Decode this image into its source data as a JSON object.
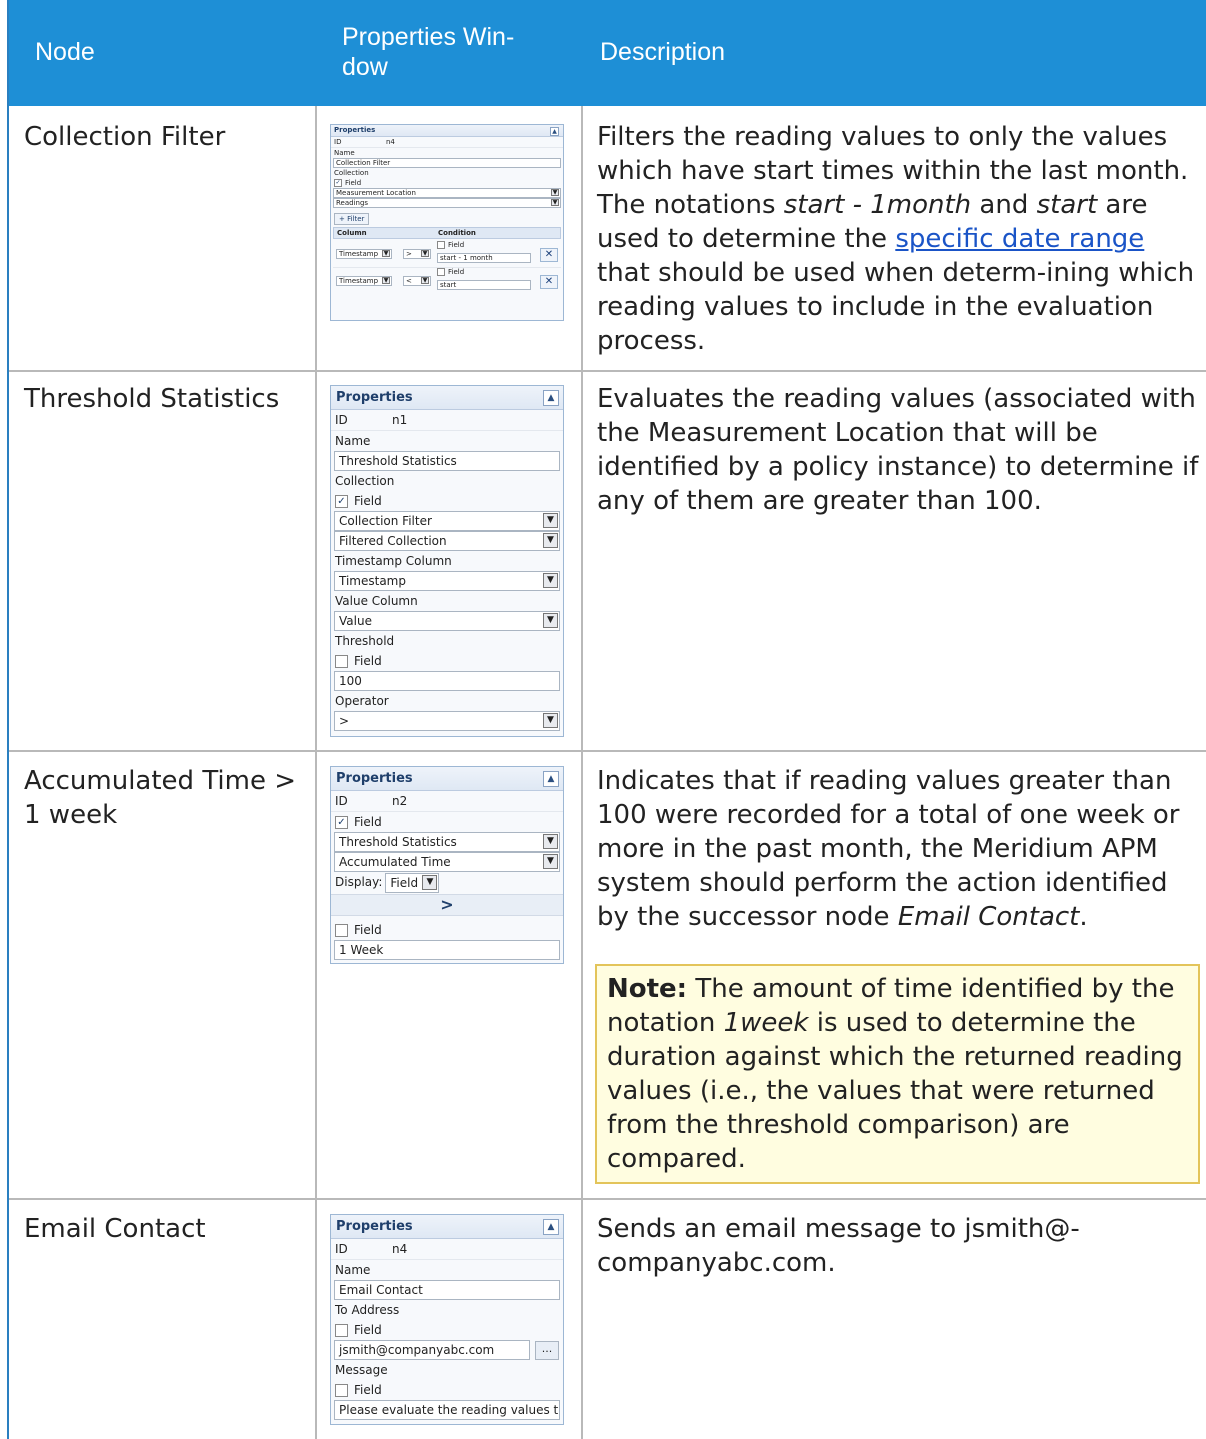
{
  "headers": {
    "node": "Node",
    "properties": "Properties Win-\ndow",
    "description": "Description"
  },
  "rows": [
    {
      "node": "Collection Filter",
      "desc_parts": [
        "Filters the reading values to only the values which have start times within the last month. The notations ",
        "start - 1month",
        " and ",
        "start",
        " are used to determine the ",
        "specific date range",
        " that should be used when determ-ining which reading values to include in the evaluation process."
      ],
      "panel": {
        "title": "Properties",
        "id_label": "ID",
        "id_value": "n4",
        "name_label": "Name",
        "name_value": "Collection Filter",
        "collection_label": "Collection",
        "field_label": "Field",
        "collection_1": "Measurement Location",
        "collection_2": "Readings",
        "filter_button": "+ Filter",
        "col_header": "Column",
        "cond_header": "Condition",
        "filter_rows": [
          {
            "column": "Timestamp",
            "op": ">",
            "field": "Field",
            "value": "start - 1 month"
          },
          {
            "column": "Timestamp",
            "op": "<",
            "field": "Field",
            "value": "start"
          }
        ]
      }
    },
    {
      "node": "Threshold Statistics",
      "description": "Evaluates the reading values (associated with the Measurement Location that will be identified by a policy instance) to determine if any of them are greater than 100.",
      "panel": {
        "title": "Properties",
        "id_label": "ID",
        "id_value": "n1",
        "name_label": "Name",
        "name_value": "Threshold Statistics",
        "collection_label": "Collection",
        "field_label": "Field",
        "collection_1": "Collection Filter",
        "collection_2": "Filtered Collection",
        "timestamp_label": "Timestamp Column",
        "timestamp_value": "Timestamp",
        "value_label": "Value Column",
        "value_value": "Value",
        "threshold_label": "Threshold",
        "threshold_value": "100",
        "operator_label": "Operator",
        "operator_value": ">"
      }
    },
    {
      "node": "Accumulated Time >\n1 week",
      "desc_parts": [
        "Indicates that if reading values greater than 100 were recorded for a total of one week or more in the past month, the Meridium APM system should perform the action identified by the successor node ",
        "Email Contact",
        "."
      ],
      "note_parts": [
        "Note:",
        " The amount of time identified by the notation ",
        "1week",
        " is used to determine the duration against which the returned reading values (i.e., the values that were returned from the threshold comparison) are compared."
      ],
      "panel": {
        "title": "Properties",
        "id_label": "ID",
        "id_value": "n2",
        "field_label": "Field",
        "collection_1": "Threshold Statistics",
        "collection_2": "Accumulated Time",
        "display_label": "Display:",
        "display_value": "Field",
        "operator": ">",
        "value": "1 Week"
      }
    },
    {
      "node": "Email Contact",
      "description": "Sends an email message to jsmith@-\ncompanyabc.com.",
      "panel": {
        "title": "Properties",
        "id_label": "ID",
        "id_value": "n4",
        "name_label": "Name",
        "name_value": "Email Contact",
        "to_label": "To Address",
        "field_label": "Field",
        "to_value": "jsmith@companyabc.com",
        "browse": "...",
        "message_label": "Message",
        "message_value": "Please evaluate the reading values th"
      }
    }
  ]
}
